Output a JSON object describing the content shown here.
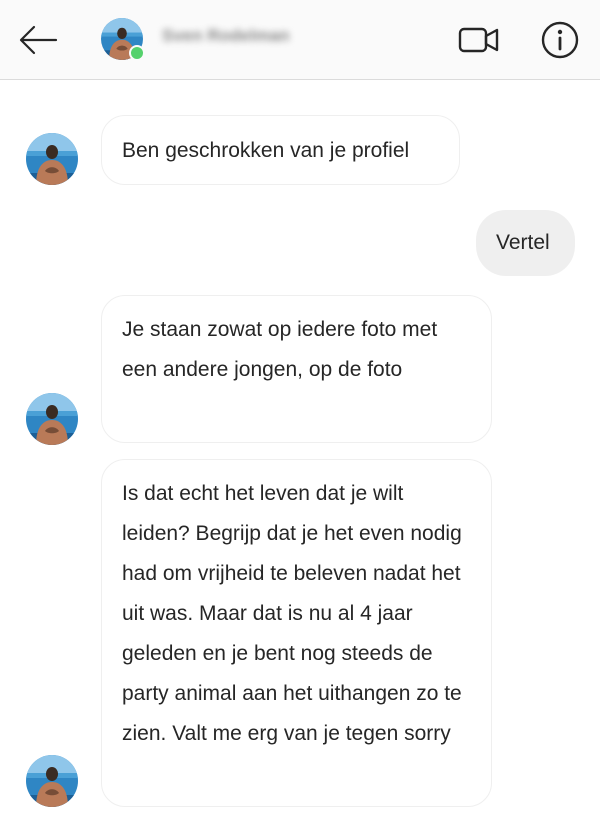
{
  "header": {
    "back_icon": "arrow-left-icon",
    "contact_name": "Sven Rodelman",
    "online_status_color": "#55d16c",
    "video_icon": "video-camera-icon",
    "info_icon": "info-circle-icon"
  },
  "messages": [
    {
      "direction": "incoming",
      "text": "Ben geschrokken van je profiel"
    },
    {
      "direction": "outgoing",
      "text": "Vertel"
    },
    {
      "direction": "incoming",
      "text": "Je staan zowat op iedere foto met een andere jongen, op de foto"
    },
    {
      "direction": "incoming",
      "text": "Is dat echt het leven dat je wilt leiden? Begrijp dat je het even nodig had om vrijheid te beleven nadat het uit was. Maar dat is nu al 4 jaar geleden en je bent nog steeds de party animal aan het uithangen zo te zien. Valt me erg van je tegen sorry"
    }
  ]
}
